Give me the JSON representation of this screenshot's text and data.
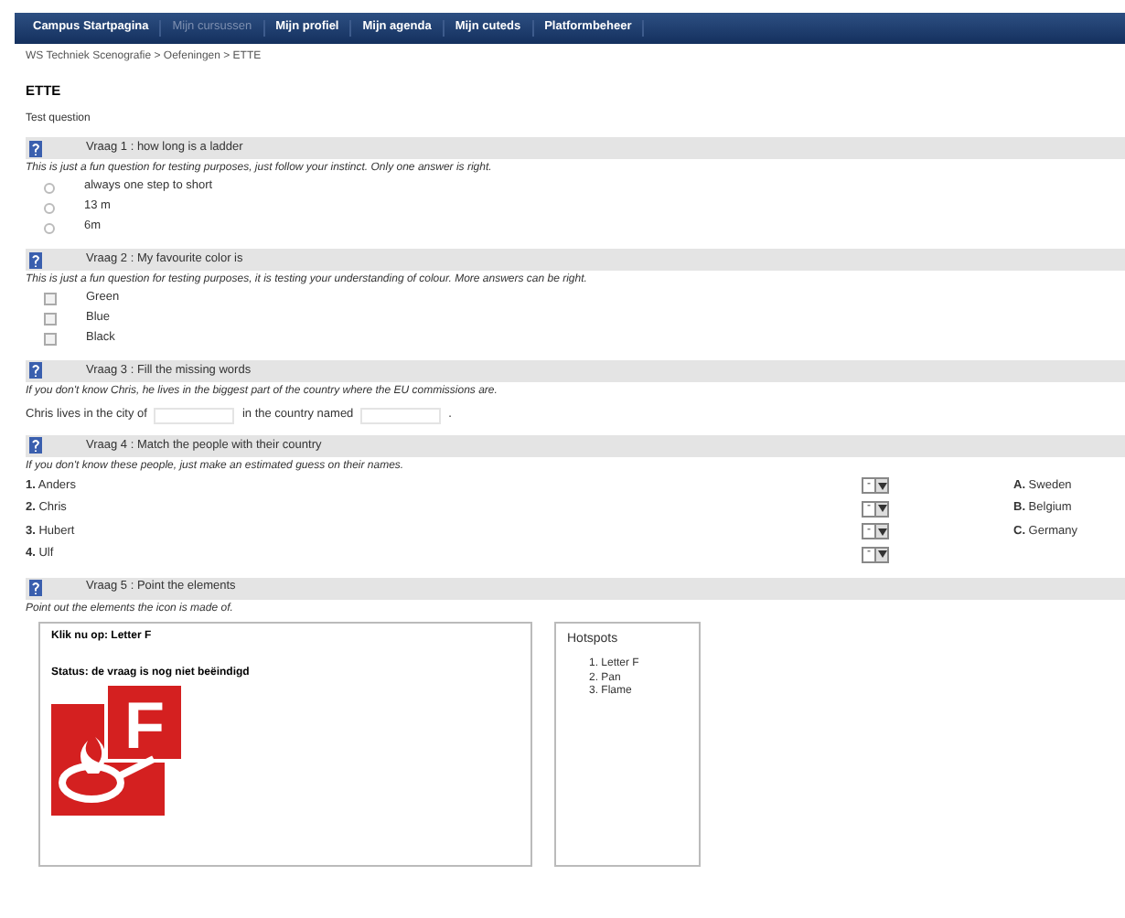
{
  "navbar": {
    "items": [
      {
        "label": "Campus Startpagina",
        "disabled": false
      },
      {
        "label": "Mijn cursussen",
        "disabled": true
      },
      {
        "label": "Mijn profiel",
        "disabled": false
      },
      {
        "label": "Mijn agenda",
        "disabled": false
      },
      {
        "label": "Mijn cuteds",
        "disabled": false
      },
      {
        "label": "Platformbeheer",
        "disabled": false
      }
    ]
  },
  "breadcrumb": "WS Techniek Scenografie > Oefeningen > ETTE",
  "title": "ETTE",
  "subtitle": "Test question",
  "questions": [
    {
      "kind": "radio",
      "title": "Vraag 1 : how long is a ladder",
      "description": "This is just a fun question for testing purposes, just follow your instinct. Only one answer is right.",
      "options": [
        {
          "label": "always one step to short",
          "selected": false
        },
        {
          "label": "13 m",
          "selected": false
        },
        {
          "label": "6m",
          "selected": false
        }
      ]
    },
    {
      "kind": "checkbox",
      "title": "Vraag 2 : My favourite color is",
      "description": "This is just a fun question for testing purposes, it is testing your understanding of colour. More  answers can be right.",
      "options": [
        {
          "label": "Green",
          "checked": false
        },
        {
          "label": "Blue",
          "checked": false
        },
        {
          "label": "Black",
          "checked": false
        }
      ]
    },
    {
      "kind": "fill",
      "title": "Vraag 3 : Fill the missing words",
      "description": "If you don't know Chris, he lives in the biggest part of the country where the EU commissions are.",
      "parts": [
        "Chris lives in the city of",
        "in the country named",
        "."
      ]
    },
    {
      "kind": "match",
      "title": "Vraag 4 : Match the people with their country",
      "description": "If you don't know these people, just make an estimated guess on their names.",
      "left": [
        {
          "number": "1.",
          "label": "Anders",
          "choice": "-"
        },
        {
          "number": "2.",
          "label": "Chris",
          "choice": "-"
        },
        {
          "number": "3.",
          "label": "Hubert",
          "choice": "-"
        },
        {
          "number": "4.",
          "label": "Ulf",
          "choice": "-"
        }
      ],
      "right": [
        {
          "letter": "A.",
          "label": "Sweden"
        },
        {
          "letter": "B.",
          "label": "Belgium"
        },
        {
          "letter": "C.",
          "label": "Germany"
        }
      ]
    },
    {
      "kind": "hotspot",
      "title": "Vraag 5 : Point the elements",
      "description": "Point out the elements the icon is made of.",
      "prompt": "Klik nu op: Letter F",
      "status": "Status: de vraag is nog niet beëindigd",
      "icon_letter": "F",
      "hotspots_title": "Hotspots",
      "hotspots": [
        {
          "number": "1.",
          "label": "Letter F"
        },
        {
          "number": "2.",
          "label": "Pan"
        },
        {
          "number": "3.",
          "label": "Flame"
        }
      ]
    }
  ]
}
